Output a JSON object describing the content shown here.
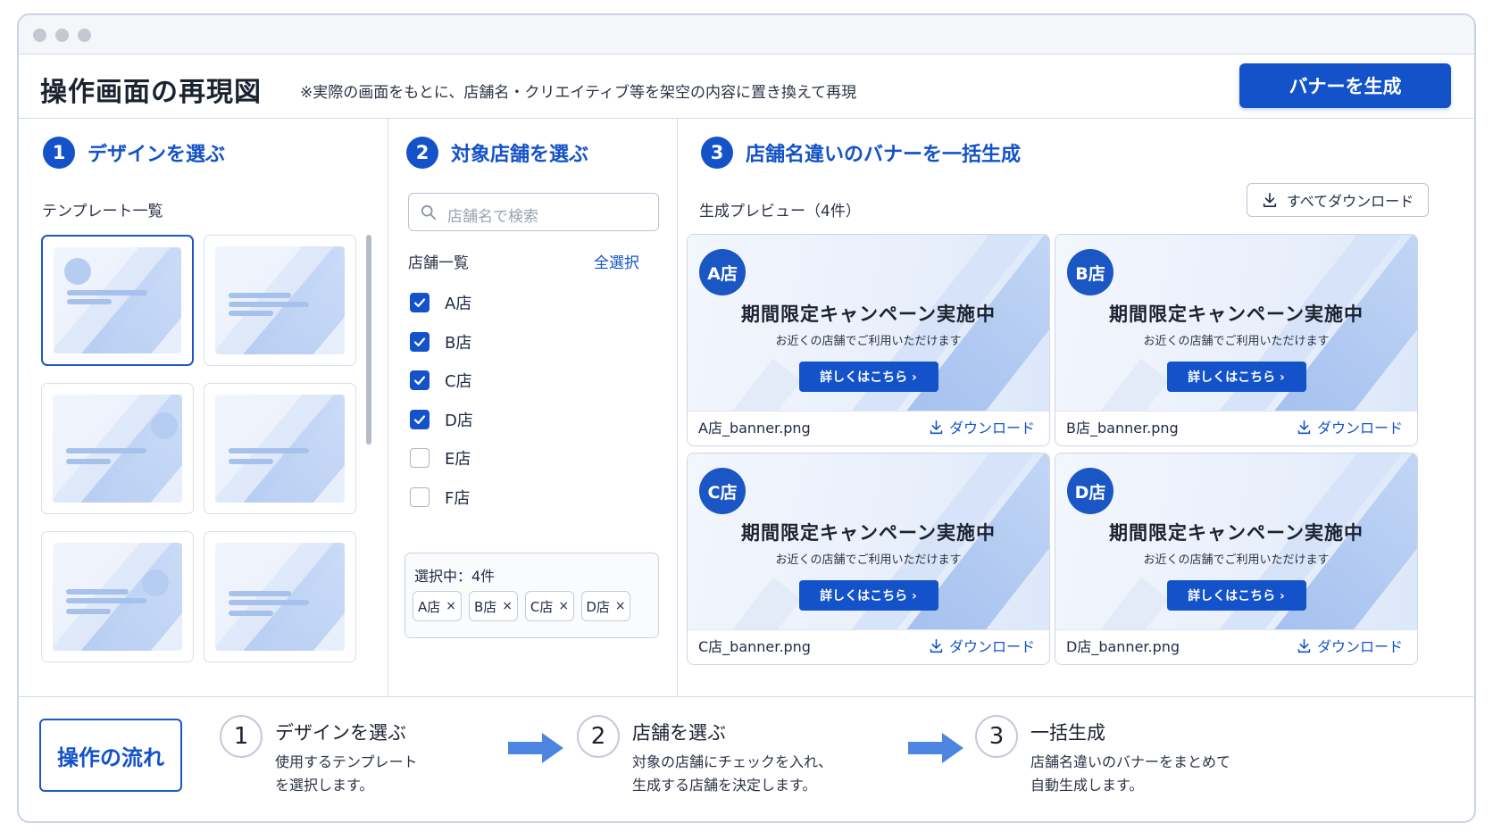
{
  "header": {
    "title": "操作画面の再現図",
    "note": "※実際の画面をもとに、店舗名・クリエイティブ等を架空の内容に置き換えて再現",
    "generate_button": "バナーを生成"
  },
  "step1": {
    "num": "1",
    "title": "デザインを選ぶ",
    "list_label": "テンプレート一覧",
    "templates_count": 6,
    "selected_template_index": 0
  },
  "step2": {
    "num": "2",
    "title": "対象店舗を選ぶ",
    "search_placeholder": "店舗名で検索",
    "list_label": "店舗一覧",
    "select_all": "全選択",
    "stores": [
      {
        "label": "A店",
        "checked": true
      },
      {
        "label": "B店",
        "checked": true
      },
      {
        "label": "C店",
        "checked": true
      },
      {
        "label": "D店",
        "checked": true
      },
      {
        "label": "E店",
        "checked": false
      },
      {
        "label": "F店",
        "checked": false
      }
    ],
    "selection_title": "選択中：4件",
    "chips": [
      "A店",
      "B店",
      "C店",
      "D店"
    ],
    "chip_remove": "×"
  },
  "step3": {
    "num": "3",
    "title": "店舗名違いのバナーを一括生成",
    "preview_label": "生成プレビュー（4件）",
    "download_all": "すべてダウンロード",
    "banners": [
      {
        "badge": "A店",
        "title": "期間限定キャンペーン実施中",
        "sub": "お近くの店舗でご利用いただけます",
        "cta": "詳しくはこちら ›",
        "filename": "A店_banner.png",
        "download": "ダウンロード"
      },
      {
        "badge": "B店",
        "title": "期間限定キャンペーン実施中",
        "sub": "お近くの店舗でご利用いただけます",
        "cta": "詳しくはこちら ›",
        "filename": "B店_banner.png",
        "download": "ダウンロード"
      },
      {
        "badge": "C店",
        "title": "期間限定キャンペーン実施中",
        "sub": "お近くの店舗でご利用いただけます",
        "cta": "詳しくはこちら ›",
        "filename": "C店_banner.png",
        "download": "ダウンロード"
      },
      {
        "badge": "D店",
        "title": "期間限定キャンペーン実施中",
        "sub": "お近くの店舗でご利用いただけます",
        "cta": "詳しくはこちら ›",
        "filename": "D店_banner.png",
        "download": "ダウンロード"
      }
    ]
  },
  "flow": {
    "label": "操作の流れ",
    "steps": [
      {
        "num": "1",
        "title": "デザインを選ぶ",
        "desc1": "使用するテンプレート",
        "desc2": "を選択します。"
      },
      {
        "num": "2",
        "title": "店舗を選ぶ",
        "desc1": "対象の店舗にチェックを入れ、",
        "desc2": "生成する店舗を決定します。"
      },
      {
        "num": "3",
        "title": "一括生成",
        "desc1": "店舗名違いのバナーをまとめて",
        "desc2": "自動生成します。"
      }
    ]
  },
  "colors": {
    "accent": "#1352c9",
    "border": "#d3dbe8",
    "unchecked": "#aab3c2"
  }
}
